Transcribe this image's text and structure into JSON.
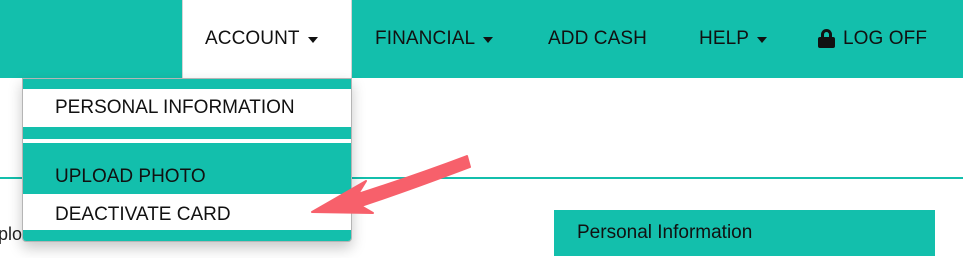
{
  "nav": {
    "account": "ACCOUNT",
    "financial": "FINANCIAL",
    "add_cash": "ADD CASH",
    "help": "HELP",
    "log_off": "LOG OFF"
  },
  "account_menu": {
    "items": [
      "PERSONAL INFORMATION",
      "UPLOAD PHOTO",
      "DEACTIVATE CARD"
    ],
    "highlighted": "DEACTIVATE CARD"
  },
  "page": {
    "partial_text": "plo",
    "panel_title": "Personal Information"
  },
  "annotation": {
    "type": "arrow",
    "points_to": "DEACTIVATE CARD",
    "color": "#f7606b"
  },
  "colors": {
    "brand": "#13bfac",
    "text": "#111111",
    "background": "#ffffff"
  },
  "icons": [
    "chevron-down-icon",
    "lock-icon"
  ]
}
